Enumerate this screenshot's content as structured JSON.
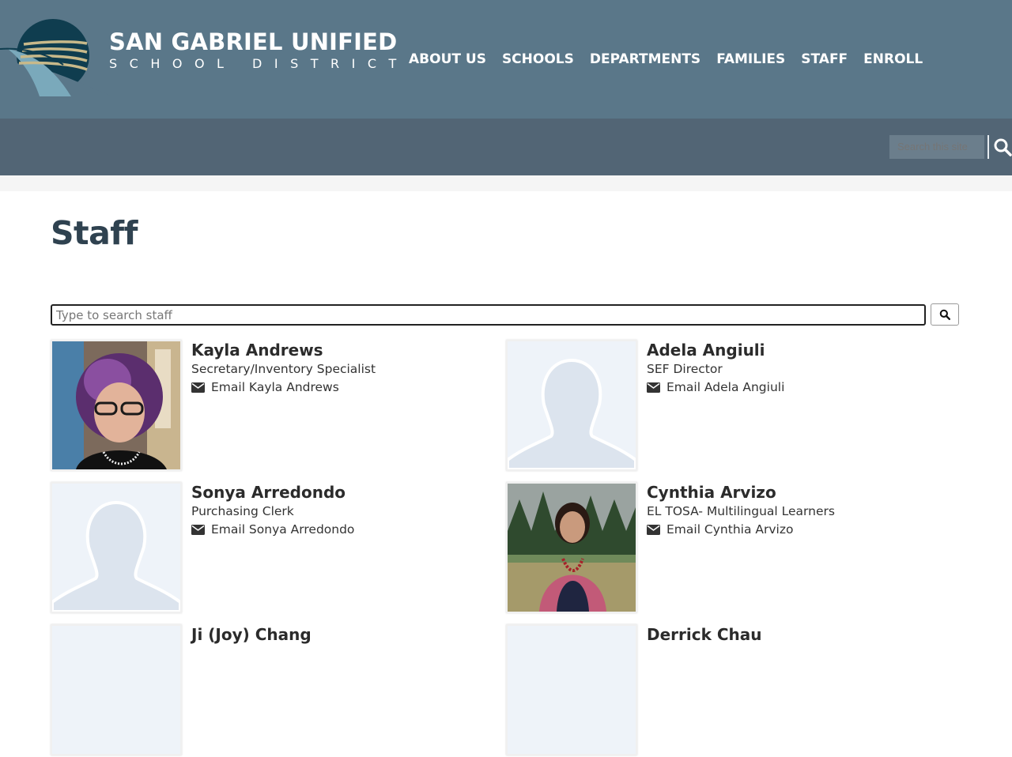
{
  "brand": {
    "title": "SAN GABRIEL UNIFIED",
    "subtitle": "SCHOOL DISTRICT"
  },
  "nav": [
    {
      "label": "ABOUT US"
    },
    {
      "label": "SCHOOLS"
    },
    {
      "label": "DEPARTMENTS"
    },
    {
      "label": "FAMILIES"
    },
    {
      "label": "STAFF"
    },
    {
      "label": "ENROLL"
    }
  ],
  "site_search": {
    "placeholder": "Search this site",
    "icon": "search-icon"
  },
  "page": {
    "title": "Staff"
  },
  "staff_search": {
    "placeholder": "Type to search staff",
    "value": "",
    "icon": "search-icon"
  },
  "staff": [
    {
      "name": "Kayla Andrews",
      "title": "Secretary/Inventory Specialist",
      "email_label": "Email Kayla Andrews",
      "photo": "portrait-woman-purple-hair"
    },
    {
      "name": "Adela Angiuli",
      "title": "SEF Director",
      "email_label": "Email Adela Angiuli",
      "photo": "placeholder-silhouette"
    },
    {
      "name": "Sonya Arredondo",
      "title": "Purchasing Clerk",
      "email_label": "Email Sonya Arredondo",
      "photo": "placeholder-silhouette"
    },
    {
      "name": "Cynthia Arvizo",
      "title": "EL TOSA- Multilingual Learners",
      "email_label": "Email Cynthia Arvizo",
      "photo": "portrait-woman-outdoors"
    },
    {
      "name": "Ji (Joy) Chang",
      "title": "",
      "email_label": "",
      "photo": "placeholder-silhouette"
    },
    {
      "name": "Derrick Chau",
      "title": "",
      "email_label": "",
      "photo": "placeholder-silhouette"
    }
  ],
  "colors": {
    "header": "#5a7789",
    "subbar": "#526575",
    "title": "#2f4250"
  }
}
